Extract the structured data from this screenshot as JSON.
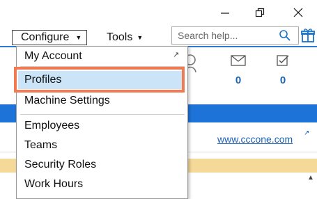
{
  "window": {
    "minimize_icon": "minimize-icon",
    "restore_icon": "restore-icon",
    "close_icon": "close-icon"
  },
  "toolbar": {
    "configure_label": "Configure",
    "tools_label": "Tools",
    "search_placeholder": "Search help...",
    "search_icon": "search-icon",
    "gift_icon": "gift-icon"
  },
  "dropdown": {
    "items": [
      {
        "label": "My Account"
      },
      {
        "label": "Profiles"
      },
      {
        "label": "Machine Settings"
      },
      {
        "label": "Employees"
      },
      {
        "label": "Teams"
      },
      {
        "label": "Security Roles"
      },
      {
        "label": "Work Hours"
      }
    ],
    "selected": "Profiles",
    "highlight_color": "#f07a52"
  },
  "background": {
    "stats": [
      {
        "icon": "mail-icon",
        "value": "0"
      },
      {
        "icon": "checklist-icon",
        "value": "0"
      }
    ],
    "link_text": "www.cccone.com",
    "accent_blue": "#1e73d8",
    "tan": "#f5d998"
  }
}
